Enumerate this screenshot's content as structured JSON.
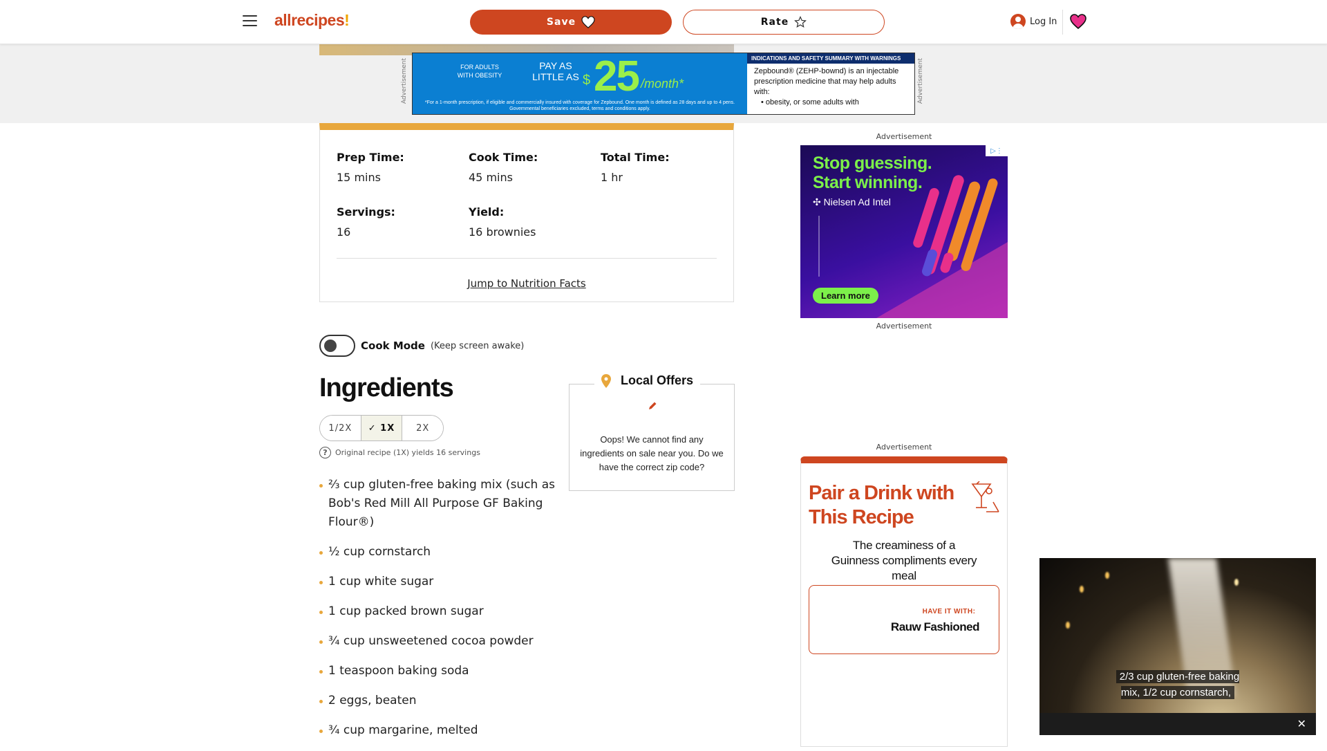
{
  "header": {
    "logo_text": "allrecipes",
    "logo_mark": "!",
    "save_label": "Save",
    "rate_label": "Rate",
    "login_label": "Log In"
  },
  "top_ad": {
    "side_label": "Advertisement",
    "adults": "FOR ADULTS WITH OBESITY",
    "pay_line": "PAY AS LITTLE AS",
    "dollar": "$",
    "amount": "25",
    "per": "/month*",
    "fine_print": "*For a 1-month prescription, if eligible and commercially insured with coverage for Zepbound. One month is defined as 28 days and up to 4 pens. Governmental beneficiaries excluded, terms and conditions apply.",
    "safety_header": "INDICATIONS AND SAFETY SUMMARY WITH WARNINGS",
    "safety_body": "Zepbound® (ZEHP-bownd) is an injectable prescription medicine that may help adults with:",
    "safety_bullet": "• obesity, or some adults with"
  },
  "details": {
    "prep_label": "Prep Time:",
    "prep_value": "15 mins",
    "cook_label": "Cook Time:",
    "cook_value": "45 mins",
    "total_label": "Total Time:",
    "total_value": "1 hr",
    "servings_label": "Servings:",
    "servings_value": "16",
    "yield_label": "Yield:",
    "yield_value": "16 brownies",
    "jump_link": "Jump to Nutrition Facts"
  },
  "cook_mode": {
    "label": "Cook Mode",
    "sub": "(Keep screen awake)"
  },
  "ingredients": {
    "title": "Ingredients",
    "scales": [
      "1/2X",
      "✓ 1X",
      "2X"
    ],
    "original_note": "Original recipe (1X) yields 16 servings",
    "items": [
      "⅔ cup gluten-free baking mix (such as Bob's Red Mill All Purpose GF Baking Flour®)",
      "½ cup cornstarch",
      "1 cup white sugar",
      "1 cup packed brown sugar",
      "¾ cup unsweetened cocoa powder",
      "1 teaspoon baking soda",
      "2 eggs, beaten",
      "¾ cup margarine, melted"
    ]
  },
  "local_offers": {
    "title": "Local Offers",
    "message": "Oops! We cannot find any ingredients on sale near you. Do we have the correct zip code?"
  },
  "right_rail": {
    "ad_label_1": "Advertisement",
    "ad_label_2": "Advertisement",
    "ad_label_3": "Advertisement",
    "nielsen_headline": "Stop guessing. Start winning.",
    "nielsen_brand": "✣ Nielsen Ad Intel",
    "nielsen_cta": "Learn more",
    "drink_title": "Pair a Drink with This Recipe",
    "drink_sub": "The creaminess of a Guinness compliments every meal",
    "have_it_with": "HAVE IT WITH:",
    "drink_name": "Rauw Fashioned"
  },
  "video": {
    "caption": "2/3 cup gluten-free baking mix, 1/2 cup cornstarch,",
    "close": "✕"
  },
  "colors": {
    "brand": "#ce4620",
    "accent": "#e8a73c"
  }
}
